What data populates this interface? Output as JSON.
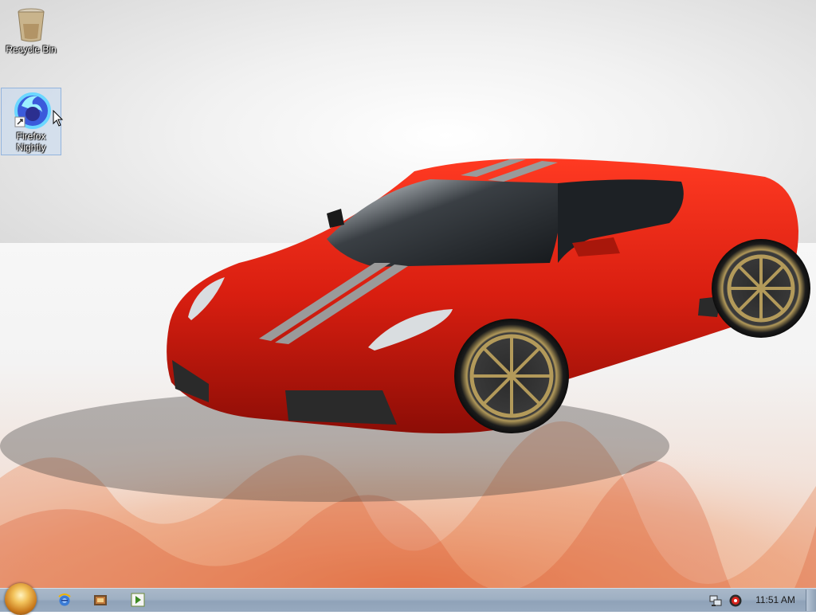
{
  "desktop": {
    "icons": [
      {
        "label": "Recycle Bin",
        "icon": "recycle-bin-icon"
      },
      {
        "label": "Firefox Nightly",
        "icon": "firefox-nightly-icon",
        "selected": true
      }
    ]
  },
  "taskbar": {
    "start_icon": "start-orb-icon",
    "pinned": [
      {
        "icon": "internet-explorer-icon"
      },
      {
        "icon": "windows-explorer-icon"
      },
      {
        "icon": "media-player-icon"
      }
    ],
    "tray": {
      "icons": [
        "network-icon",
        "volume-icon"
      ],
      "clock": "11:51 AM"
    }
  },
  "colors": {
    "taskbar": "#9fb0c3",
    "car_red": "#d81e10",
    "selection": "#bed7f5"
  }
}
